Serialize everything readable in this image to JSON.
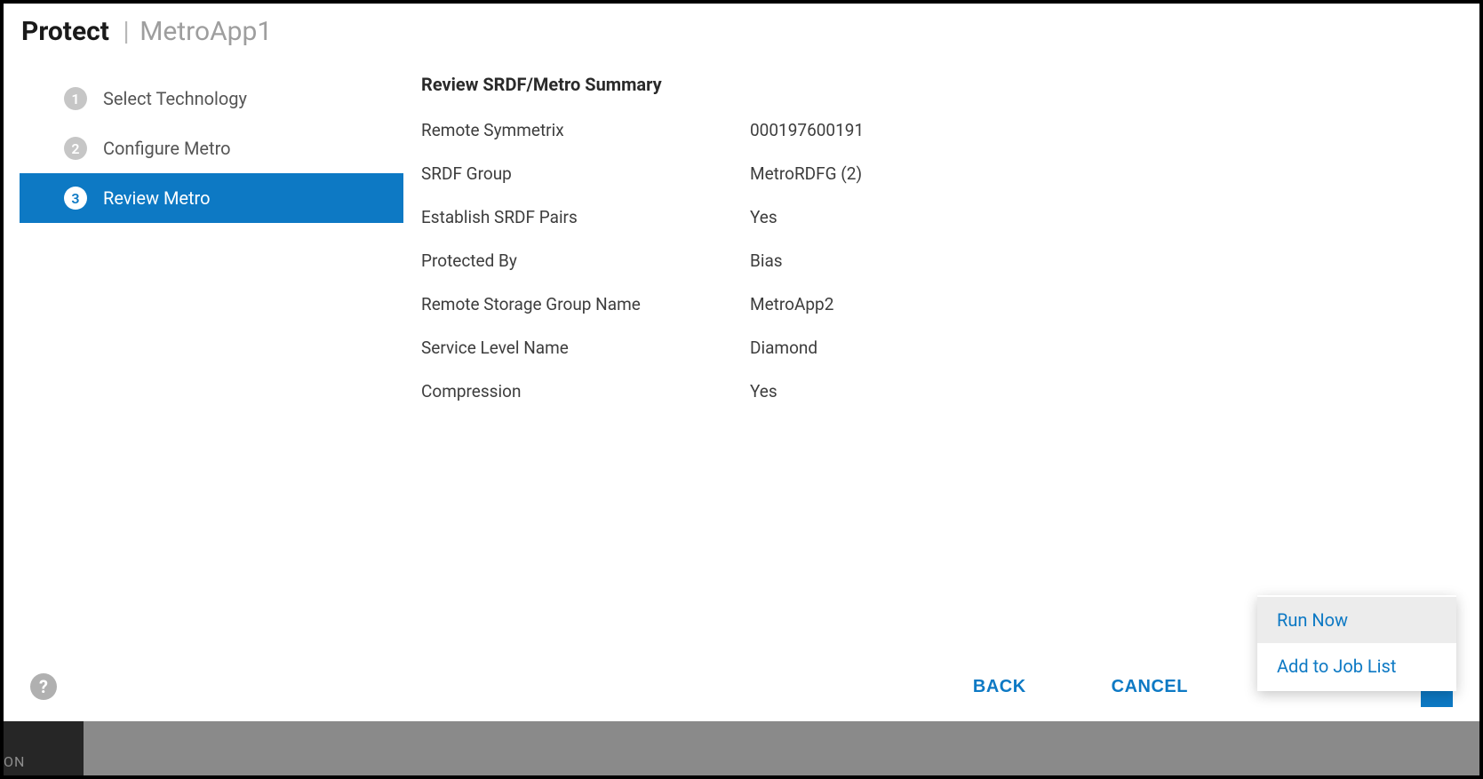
{
  "header": {
    "title": "Protect",
    "separator": "|",
    "subtitle": "MetroApp1"
  },
  "wizard": {
    "steps": [
      {
        "num": "1",
        "label": "Select Technology",
        "active": false
      },
      {
        "num": "2",
        "label": "Configure Metro",
        "active": false
      },
      {
        "num": "3",
        "label": "Review Metro",
        "active": true
      }
    ]
  },
  "summary": {
    "title": "Review SRDF/Metro Summary",
    "rows": [
      {
        "label": "Remote Symmetrix",
        "value": "000197600191"
      },
      {
        "label": "SRDF Group",
        "value": "MetroRDFG (2)"
      },
      {
        "label": "Establish SRDF Pairs",
        "value": "Yes"
      },
      {
        "label": "Protected By",
        "value": "Bias"
      },
      {
        "label": "Remote Storage Group Name",
        "value": "MetroApp2"
      },
      {
        "label": "Service Level Name",
        "value": "Diamond"
      },
      {
        "label": "Compression",
        "value": "Yes"
      }
    ]
  },
  "footer": {
    "back": "BACK",
    "cancel": "CANCEL",
    "menu": [
      {
        "label": "Run Now",
        "highlighted": true
      },
      {
        "label": "Add to Job List",
        "highlighted": false
      }
    ]
  },
  "backdrop": {
    "partial": "ON"
  },
  "icons": {
    "help": "?"
  }
}
